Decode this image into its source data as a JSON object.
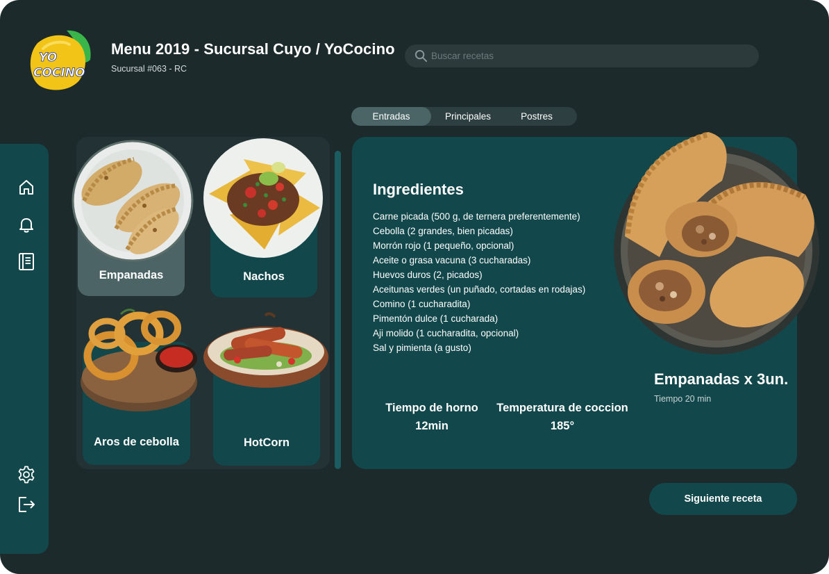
{
  "header": {
    "logo_text_line1": "YO",
    "logo_text_line2": "COCINO",
    "title": "Menu 2019 - Sucursal Cuyo / YoCocino",
    "subtitle": "Sucursal #063 - RC"
  },
  "search": {
    "placeholder": "Buscar recetas",
    "value": ""
  },
  "tabs": [
    {
      "label": "Entradas",
      "active": true
    },
    {
      "label": "Principales",
      "active": false
    },
    {
      "label": "Postres",
      "active": false
    }
  ],
  "sidebar": {
    "top_icons": [
      "home-icon",
      "bell-icon",
      "book-icon"
    ],
    "bottom_icons": [
      "settings-icon",
      "logout-icon"
    ]
  },
  "menu_items": [
    {
      "label": "Empanadas",
      "icon": "empanadas-image",
      "selected": true
    },
    {
      "label": "Nachos",
      "icon": "nachos-image",
      "selected": false
    },
    {
      "label": "Aros de cebolla",
      "icon": "onion-rings-image",
      "selected": false
    },
    {
      "label": "HotCorn",
      "icon": "hotcorn-image",
      "selected": false
    }
  ],
  "recipe": {
    "ingredients_title": "Ingredientes",
    "ingredients": [
      "Carne picada (500 g, de ternera preferentemente)",
      "Cebolla (2 grandes, bien picadas)",
      "Morrón rojo (1 pequeño, opcional)",
      "Aceite o grasa vacuna (3 cucharadas)",
      "Huevos duros (2, picados)",
      "Aceitunas verdes (un puñado, cortadas en rodajas)",
      "Comino (1 cucharadita)",
      "Pimentón dulce (1 cucharada)",
      "Aji molido (1 cucharadita, opcional)",
      "Sal y pimienta (a gusto)"
    ],
    "stats": [
      {
        "label": "Tiempo de horno",
        "value": "12min"
      },
      {
        "label": "Temperatura de coccion",
        "value": "185°"
      }
    ],
    "dish_name": "Empanadas x 3un.",
    "dish_time": "Tiempo 20 min"
  },
  "next_button": "Siguiente receta",
  "colors": {
    "background": "#1d2a2c",
    "panel": "#12484c",
    "menu_panel": "#233234",
    "active_card": "#4d6466",
    "logo_yellow": "#f2c418",
    "logo_green": "#39b54a"
  }
}
